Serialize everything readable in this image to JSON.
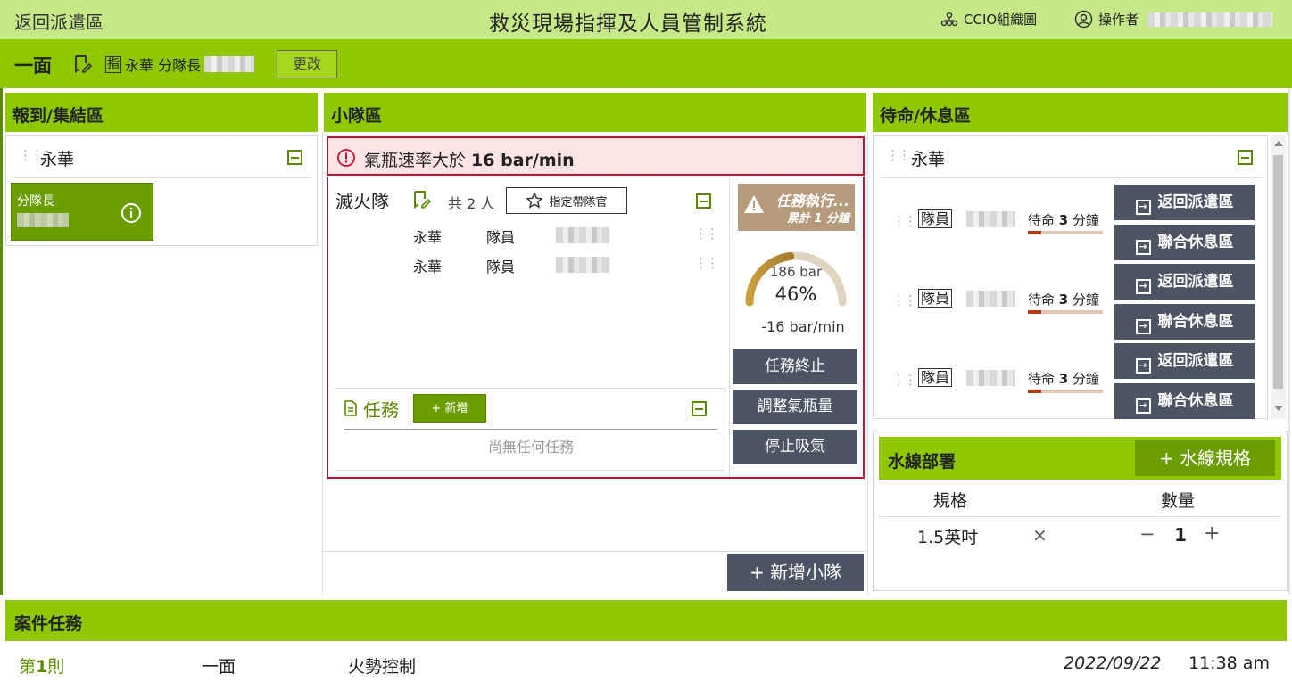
{
  "header": {
    "back_label": "返回派遣區",
    "title": "救災現場指揮及人員管制系統",
    "org_chart_label": "CCIO組織圖",
    "operator_label": "操作者"
  },
  "section": {
    "face": "一面",
    "commander_mark": "指",
    "commander_text": "永華 分隊長",
    "change_label": "更改"
  },
  "checkin": {
    "title": "報到/集結區",
    "group_name": "永華",
    "card_role": "分隊長"
  },
  "team_area": {
    "title": "小隊區",
    "alert_text": "氣瓶速率大於 ",
    "alert_value": "16 bar/min",
    "team_name": "滅火隊",
    "count_label": "共 2 人",
    "assign_leader_label": "指定帶隊官",
    "members": [
      {
        "unit": "永華",
        "role": "隊員"
      },
      {
        "unit": "永華",
        "role": "隊員"
      }
    ],
    "status_title": "任務執行...",
    "status_sub": "累計 1 分鐘",
    "gauge": {
      "pressure": "186 bar",
      "percent_label": "46%",
      "percent": 0.46,
      "rate": "-16 bar/min"
    },
    "actions": [
      "任務終止",
      "調整氣瓶量",
      "停止吸氣"
    ],
    "tasks_label": "任務",
    "add_task_label": "+ 新增",
    "no_task_text": "尚無任何任務",
    "add_team_label": "新增小隊"
  },
  "standby": {
    "title": "待命/休息區",
    "group_name": "永華",
    "rows": [
      {
        "role": "隊員",
        "status_prefix": "待命 ",
        "minutes": "3",
        "status_suffix": " 分鐘",
        "btn1": "返回派遣區",
        "btn2": "聯合休息區"
      },
      {
        "role": "隊員",
        "status_prefix": "待命 ",
        "minutes": "3",
        "status_suffix": " 分鐘",
        "btn1": "返回派遣區",
        "btn2": "聯合休息區"
      },
      {
        "role": "隊員",
        "status_prefix": "待命 ",
        "minutes": "3",
        "status_suffix": " 分鐘",
        "btn1": "返回派遣區",
        "btn2": "聯合休息區"
      }
    ]
  },
  "water": {
    "title": "水線部署",
    "add_label": "水線規格",
    "col_spec": "規格",
    "col_qty": "數量",
    "spec": "1.5英吋",
    "times": "×",
    "qty": "1",
    "minus": "−",
    "plus": "+"
  },
  "case_tasks": {
    "title": "案件任務",
    "row": {
      "index_prefix": "第",
      "index_num": "1",
      "index_suffix": "則",
      "unit": "一面",
      "task": "火勢控制",
      "date": "2022/09/22",
      "time": "11:38 am"
    }
  },
  "colors": {
    "header_bg": "#c5e889",
    "green_bar": "#8fc800",
    "dark_button": "#4d5463",
    "alert_red": "#c8102e",
    "status_tan": "#b69a7c"
  }
}
